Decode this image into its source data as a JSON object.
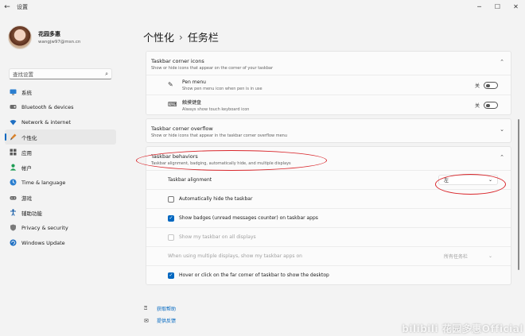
{
  "app": {
    "title": "设置",
    "back": "←"
  },
  "window_controls": {
    "minimize": "─",
    "maximize": "☐",
    "close": "✕"
  },
  "profile": {
    "name": "花园多惠",
    "email": "wangjw97@msn.cn"
  },
  "search": {
    "placeholder": "查找设置",
    "icon": "search-icon"
  },
  "nav": {
    "items": [
      {
        "label": "系统",
        "icon": "monitor-icon",
        "selected": false
      },
      {
        "label": "Bluetooth & devices",
        "icon": "bluetooth-icon",
        "selected": false
      },
      {
        "label": "Network & internet",
        "icon": "wifi-icon",
        "selected": false
      },
      {
        "label": "个性化",
        "icon": "brush-icon",
        "selected": true
      },
      {
        "label": "应用",
        "icon": "apps-icon",
        "selected": false
      },
      {
        "label": "帐户",
        "icon": "person-icon",
        "selected": false
      },
      {
        "label": "Time & language",
        "icon": "globe-clock-icon",
        "selected": false
      },
      {
        "label": "游戏",
        "icon": "gamepad-icon",
        "selected": false
      },
      {
        "label": "辅助功能",
        "icon": "accessibility-icon",
        "selected": false
      },
      {
        "label": "Privacy & security",
        "icon": "shield-icon",
        "selected": false
      },
      {
        "label": "Windows Update",
        "icon": "update-icon",
        "selected": false
      }
    ]
  },
  "breadcrumb": {
    "parent": "个性化",
    "separator": "›",
    "current": "任务栏"
  },
  "corner_icons": {
    "title": "Taskbar corner icons",
    "subtitle": "Show or hide icons that appear on the corner of your taskbar",
    "items": [
      {
        "title": "Pen menu",
        "desc": "Show pen menu icon when pen is in use",
        "state": "关",
        "icon": "pen-icon"
      },
      {
        "title": "触摸键盘",
        "desc": "Always show touch keyboard icon",
        "state": "关",
        "icon": "keyboard-icon"
      }
    ]
  },
  "corner_overflow": {
    "title": "Taskbar corner overflow",
    "subtitle": "Show or hide icons that appear in the taskbar corner overflow menu"
  },
  "behaviors": {
    "title": "Taskbar behaviors",
    "subtitle": "Taskbar alignment, badging, automatically hide, and multiple displays",
    "alignment_label": "Taskbar alignment",
    "alignment_value": "左",
    "auto_hide": "Automatically hide the taskbar",
    "badges": "Show badges (unread messages counter) on taskbar apps",
    "all_displays": "Show my taskbar on all displays",
    "multi_display_label": "When using multiple displays, show my taskbar apps on",
    "multi_display_value": "所有任务栏",
    "hover_corner": "Hover or click on the far corner of taskbar to show the desktop"
  },
  "footer": {
    "help": "获取帮助",
    "feedback": "提供反馈"
  },
  "watermark": "bilibili 花园多惠Official",
  "colors": {
    "accent": "#0067c0",
    "annotation": "#d9262b",
    "background": "#f3f3f3"
  }
}
